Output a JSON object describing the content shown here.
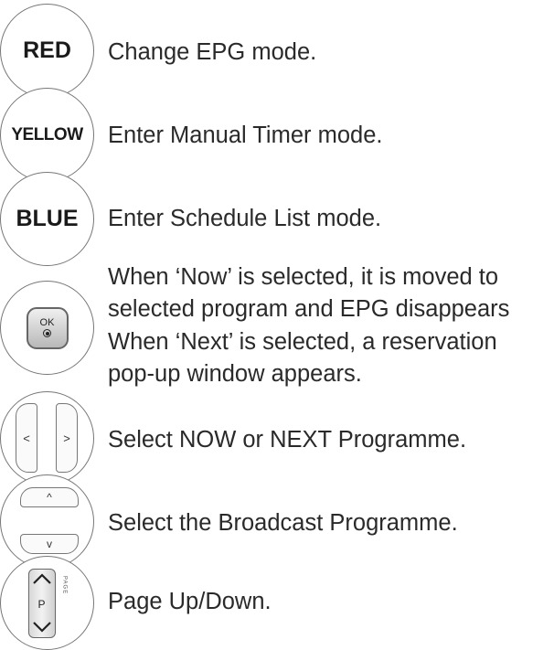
{
  "rows": [
    {
      "key_label": "RED",
      "description": "Change EPG mode."
    },
    {
      "key_label": "YELLOW",
      "description": "Enter Manual Timer mode."
    },
    {
      "key_label": "BLUE",
      "description": "Enter Schedule List mode."
    },
    {
      "key_label": "OK",
      "description_lines": [
        "When ‘Now’ is selected, it is moved to",
        "selected program and EPG disappears",
        "When ‘Next’ is selected, a reservation",
        "pop-up window appears."
      ]
    },
    {
      "key_label_left": "<",
      "key_label_right": ">",
      "description": "Select NOW or NEXT Programme."
    },
    {
      "key_label_up": "^",
      "key_label_down": "v",
      "description": "Select the Broadcast Programme."
    },
    {
      "key_label": "P",
      "key_side_label": "PAGE",
      "description": "Page Up/Down."
    }
  ]
}
